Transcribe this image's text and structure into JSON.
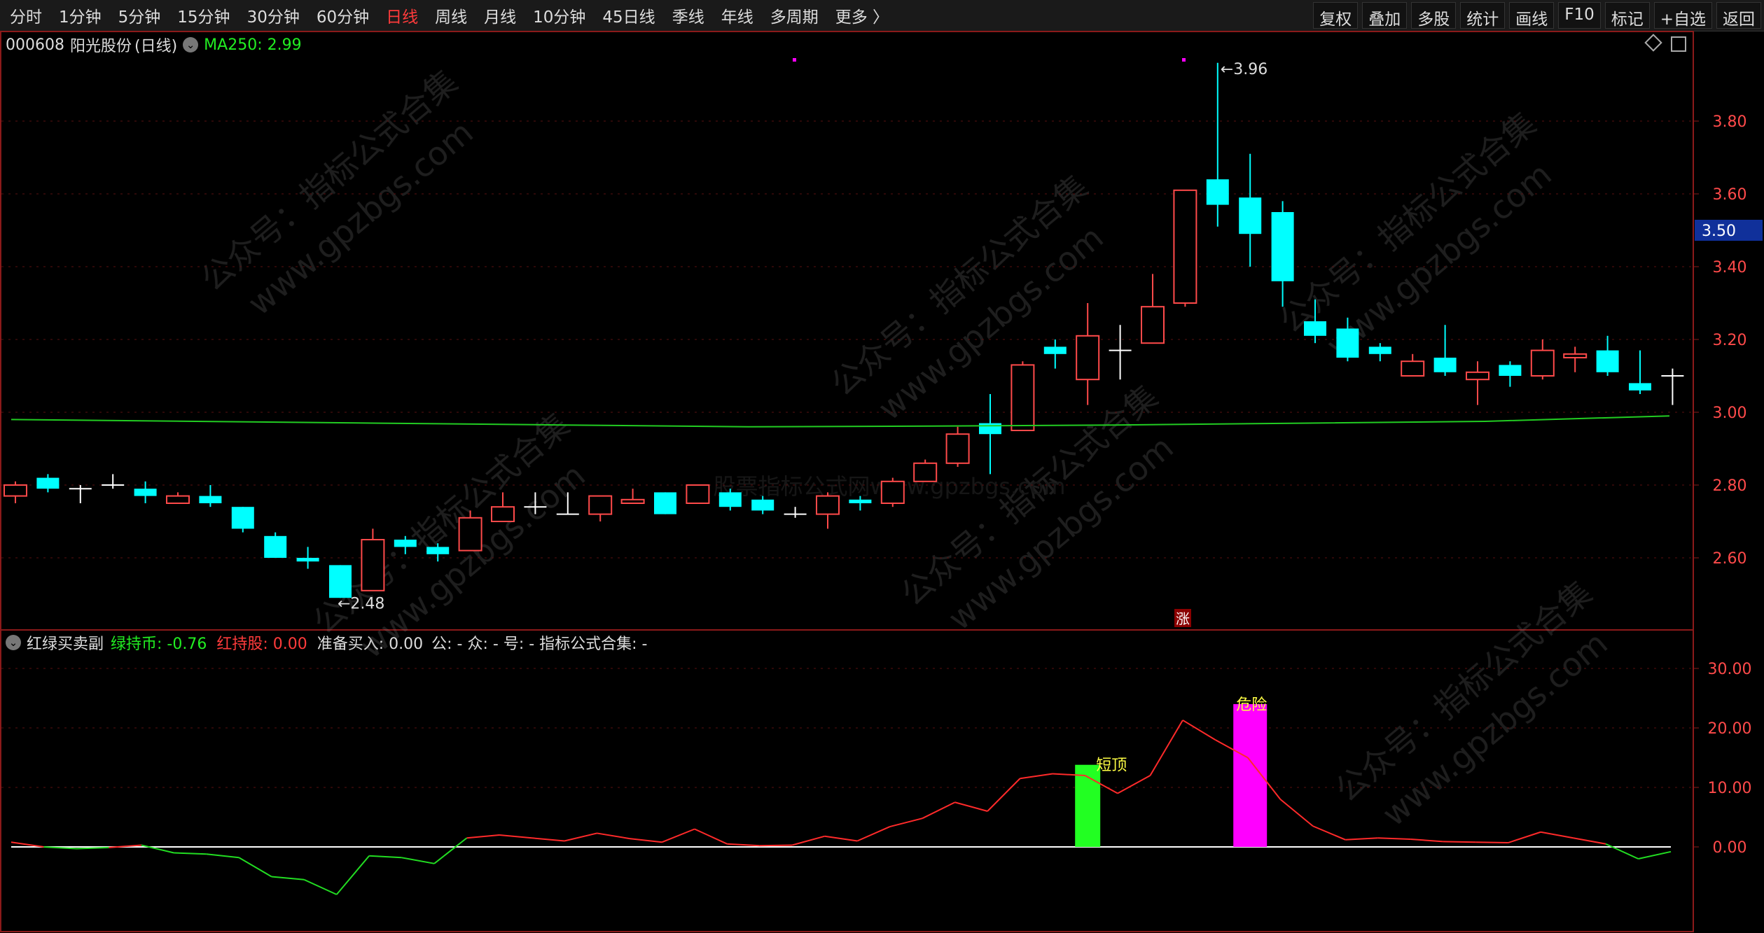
{
  "toolbar": {
    "periods": [
      "分时",
      "1分钟",
      "5分钟",
      "15分钟",
      "30分钟",
      "60分钟",
      "日线",
      "周线",
      "月线",
      "10分钟",
      "45日线",
      "季线",
      "年线",
      "多周期",
      "更多 〉"
    ],
    "active_period": "日线",
    "actions": [
      "复权",
      "叠加",
      "多股",
      "统计",
      "画线",
      "F10",
      "标记",
      "+自选",
      "返回"
    ]
  },
  "main_header": {
    "stock_code": "000608",
    "stock_name": "阳光股份",
    "period_label": "(日线)",
    "ma_label": "MA250: 2.99"
  },
  "price_axis": {
    "ticks": [
      "3.80",
      "3.60",
      "3.40",
      "3.20",
      "3.00",
      "2.80",
      "2.60"
    ],
    "current_price": "3.50"
  },
  "annotations": {
    "high_label": "3.96",
    "low_label": "2.48",
    "up_marker": "涨"
  },
  "watermarks": [
    "公众号：指标公式合集",
    "www.gpzbgs.com",
    "股票指标公式网www.gpzbgs.com"
  ],
  "indicator_header": {
    "name": "红绿买卖副",
    "green_label": "绿持币: -0.76",
    "red_label": "红持股: 0.00",
    "prep_buy": "准备买入: 0.00",
    "rest": "公: -  众: -  号: -  指标公式合集: -"
  },
  "indicator_axis": {
    "ticks": [
      "30.00",
      "20.00",
      "10.00",
      "0.00"
    ]
  },
  "indicator_labels": {
    "green_bar": "短顶",
    "magenta_bar": "危险"
  },
  "colors": {
    "up": "#ff4a4a",
    "down": "#00ffff",
    "ma": "#22cc22",
    "green_bar": "#22ff22",
    "magenta_bar": "#ff00ff"
  },
  "chart_data": [
    {
      "type": "candlestick",
      "title": "000608 阳光股份 (日线)",
      "ylim": [
        2.44,
        3.99
      ],
      "series": [
        {
          "name": "K",
          "ohlc": [
            [
              2.77,
              2.81,
              2.75,
              2.8
            ],
            [
              2.82,
              2.83,
              2.78,
              2.79
            ],
            [
              2.79,
              2.8,
              2.75,
              2.79
            ],
            [
              2.8,
              2.83,
              2.79,
              2.8
            ],
            [
              2.79,
              2.81,
              2.75,
              2.77
            ],
            [
              2.75,
              2.78,
              2.75,
              2.77
            ],
            [
              2.77,
              2.8,
              2.74,
              2.75
            ],
            [
              2.74,
              2.74,
              2.67,
              2.68
            ],
            [
              2.66,
              2.67,
              2.6,
              2.6
            ],
            [
              2.6,
              2.63,
              2.57,
              2.59
            ],
            [
              2.58,
              2.58,
              2.49,
              2.49
            ],
            [
              2.51,
              2.68,
              2.51,
              2.65
            ],
            [
              2.65,
              2.66,
              2.61,
              2.63
            ],
            [
              2.63,
              2.64,
              2.59,
              2.61
            ],
            [
              2.62,
              2.73,
              2.62,
              2.71
            ],
            [
              2.7,
              2.78,
              2.7,
              2.74
            ],
            [
              2.74,
              2.78,
              2.72,
              2.74
            ],
            [
              2.72,
              2.78,
              2.72,
              2.72
            ],
            [
              2.72,
              2.77,
              2.7,
              2.77
            ],
            [
              2.75,
              2.79,
              2.75,
              2.76
            ],
            [
              2.78,
              2.78,
              2.72,
              2.72
            ],
            [
              2.75,
              2.8,
              2.75,
              2.8
            ],
            [
              2.78,
              2.79,
              2.73,
              2.74
            ],
            [
              2.76,
              2.77,
              2.72,
              2.73
            ],
            [
              2.72,
              2.74,
              2.71,
              2.72
            ],
            [
              2.72,
              2.78,
              2.68,
              2.77
            ],
            [
              2.76,
              2.77,
              2.73,
              2.75
            ],
            [
              2.75,
              2.82,
              2.74,
              2.81
            ],
            [
              2.81,
              2.87,
              2.81,
              2.86
            ],
            [
              2.86,
              2.96,
              2.85,
              2.94
            ],
            [
              2.97,
              3.05,
              2.83,
              2.94
            ],
            [
              2.95,
              3.14,
              2.95,
              3.13
            ],
            [
              3.18,
              3.2,
              3.12,
              3.16
            ],
            [
              3.09,
              3.3,
              3.02,
              3.21
            ],
            [
              3.17,
              3.24,
              3.09,
              3.17
            ],
            [
              3.19,
              3.38,
              3.19,
              3.29
            ],
            [
              3.3,
              3.61,
              3.29,
              3.61
            ],
            [
              3.64,
              3.96,
              3.51,
              3.57
            ],
            [
              3.59,
              3.71,
              3.4,
              3.49
            ],
            [
              3.55,
              3.58,
              3.29,
              3.36
            ],
            [
              3.25,
              3.31,
              3.19,
              3.21
            ],
            [
              3.23,
              3.26,
              3.14,
              3.15
            ],
            [
              3.18,
              3.19,
              3.14,
              3.16
            ],
            [
              3.1,
              3.16,
              3.1,
              3.14
            ],
            [
              3.15,
              3.24,
              3.1,
              3.11
            ],
            [
              3.09,
              3.14,
              3.02,
              3.11
            ],
            [
              3.13,
              3.14,
              3.07,
              3.1
            ],
            [
              3.1,
              3.2,
              3.09,
              3.17
            ],
            [
              3.15,
              3.18,
              3.11,
              3.16
            ],
            [
              3.17,
              3.21,
              3.1,
              3.11
            ],
            [
              3.08,
              3.17,
              3.05,
              3.06
            ],
            [
              3.1,
              3.12,
              3.02,
              3.1
            ]
          ]
        },
        {
          "name": "MA250",
          "values": [
            2.98,
            2.975,
            2.97,
            2.965,
            2.96,
            2.962,
            2.965,
            2.97,
            2.975,
            2.99
          ]
        }
      ]
    },
    {
      "type": "bar",
      "title": "红绿买卖副",
      "ylim": [
        -12,
        33
      ],
      "series": [
        {
          "name": "line",
          "values": [
            0.8,
            0.0,
            -0.3,
            -0.1,
            0.3,
            -1.0,
            -1.2,
            -1.8,
            -5.0,
            -5.5,
            -8.0,
            -1.5,
            -1.8,
            -2.8,
            1.5,
            2.0,
            1.5,
            1.0,
            2.3,
            1.4,
            0.8,
            3.0,
            0.5,
            0.2,
            0.3,
            1.8,
            1.0,
            3.4,
            4.8,
            7.5,
            6.0,
            11.5,
            12.3,
            12.0,
            9.0,
            12.0,
            21.3,
            18.0,
            15.0,
            8.0,
            3.5,
            1.2,
            1.5,
            1.3,
            0.9,
            0.8,
            0.7,
            2.5,
            1.5,
            0.5,
            -2.0,
            -0.8
          ]
        },
        {
          "name": "green_bar",
          "values": [
            13.8
          ]
        },
        {
          "name": "magenta_bar",
          "values": [
            24.0
          ]
        }
      ]
    }
  ]
}
